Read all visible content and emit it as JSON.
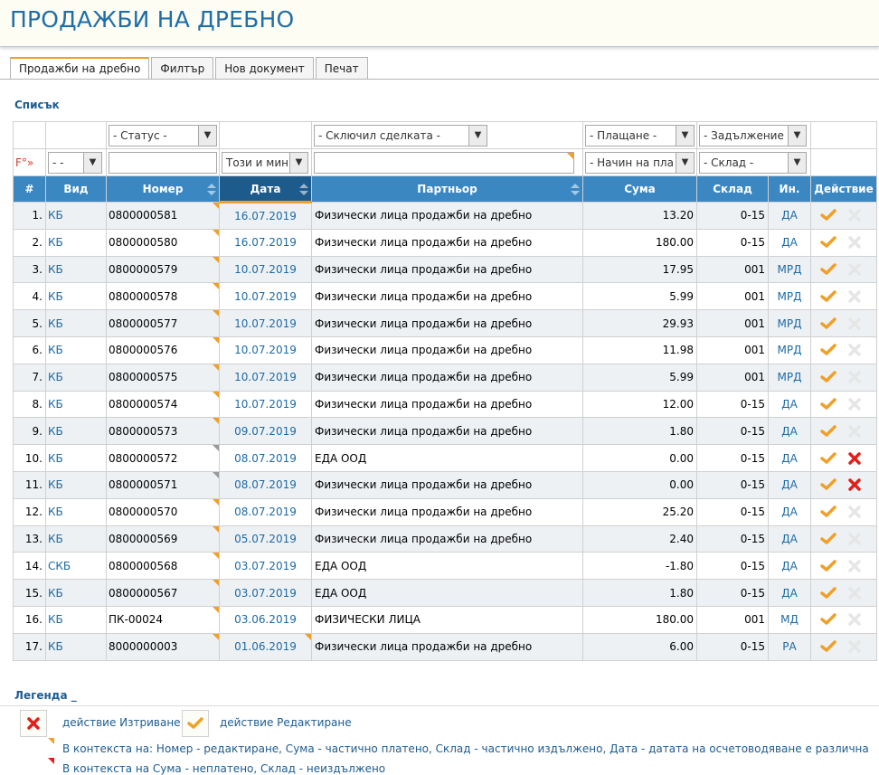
{
  "page": {
    "title": "ПРОДАЖБИ НА ДРЕБНО"
  },
  "tabs": [
    "Продажби на дребно",
    "Филтър",
    "Нов документ",
    "Печат"
  ],
  "section_title": "Списък",
  "filters": {
    "status": "- Статус -",
    "closed_by": "- Сключил сделката -",
    "payment": "- Плащане -",
    "debt": "- Задължение -",
    "fo_label": "F°»",
    "type": "- -",
    "period": "Този и мин",
    "payment_method": "- Начин на пла",
    "warehouse": "- Склад -"
  },
  "columns": [
    "#",
    "Вид",
    "Номер",
    "Дата",
    "Партньор",
    "Сума",
    "Склад",
    "Ин.",
    "Действие"
  ],
  "rows": [
    {
      "n": "1.",
      "vid": "КБ",
      "nomer": "0800000581",
      "date": "16.07.2019",
      "partner": "Физически лица продажби на дребно",
      "sum": "13.20",
      "sklad": "0-15",
      "in": "ДА",
      "del": false,
      "mark": "orange"
    },
    {
      "n": "2.",
      "vid": "КБ",
      "nomer": "0800000580",
      "date": "16.07.2019",
      "partner": "Физически лица продажби на дребно",
      "sum": "180.00",
      "sklad": "0-15",
      "in": "ДА",
      "del": false,
      "mark": "orange"
    },
    {
      "n": "3.",
      "vid": "КБ",
      "nomer": "0800000579",
      "date": "10.07.2019",
      "partner": "Физически лица продажби на дребно",
      "sum": "17.95",
      "sklad": "001",
      "in": "МРД",
      "del": false,
      "mark": "orange"
    },
    {
      "n": "4.",
      "vid": "КБ",
      "nomer": "0800000578",
      "date": "10.07.2019",
      "partner": "Физически лица продажби на дребно",
      "sum": "5.99",
      "sklad": "001",
      "in": "МРД",
      "del": false,
      "mark": "orange"
    },
    {
      "n": "5.",
      "vid": "КБ",
      "nomer": "0800000577",
      "date": "10.07.2019",
      "partner": "Физически лица продажби на дребно",
      "sum": "29.93",
      "sklad": "001",
      "in": "МРД",
      "del": false,
      "mark": "orange"
    },
    {
      "n": "6.",
      "vid": "КБ",
      "nomer": "0800000576",
      "date": "10.07.2019",
      "partner": "Физически лица продажби на дребно",
      "sum": "11.98",
      "sklad": "001",
      "in": "МРД",
      "del": false,
      "mark": "orange"
    },
    {
      "n": "7.",
      "vid": "КБ",
      "nomer": "0800000575",
      "date": "10.07.2019",
      "partner": "Физически лица продажби на дребно",
      "sum": "5.99",
      "sklad": "001",
      "in": "МРД",
      "del": false,
      "mark": "orange"
    },
    {
      "n": "8.",
      "vid": "КБ",
      "nomer": "0800000574",
      "date": "10.07.2019",
      "partner": "Физически лица продажби на дребно",
      "sum": "12.00",
      "sklad": "0-15",
      "in": "ДА",
      "del": false,
      "mark": "orange"
    },
    {
      "n": "9.",
      "vid": "КБ",
      "nomer": "0800000573",
      "date": "09.07.2019",
      "partner": "Физически лица продажби на дребно",
      "sum": "1.80",
      "sklad": "0-15",
      "in": "ДА",
      "del": false,
      "mark": "orange"
    },
    {
      "n": "10.",
      "vid": "КБ",
      "nomer": "0800000572",
      "date": "08.07.2019",
      "partner": "ЕДА ООД",
      "sum": "0.00",
      "sklad": "0-15",
      "in": "ДА",
      "del": true,
      "mark": "gray"
    },
    {
      "n": "11.",
      "vid": "КБ",
      "nomer": "0800000571",
      "date": "08.07.2019",
      "partner": "Физически лица продажби на дребно",
      "sum": "0.00",
      "sklad": "0-15",
      "in": "ДА",
      "del": true,
      "mark": "gray"
    },
    {
      "n": "12.",
      "vid": "КБ",
      "nomer": "0800000570",
      "date": "08.07.2019",
      "partner": "Физически лица продажби на дребно",
      "sum": "25.20",
      "sklad": "0-15",
      "in": "ДА",
      "del": false,
      "mark": "orange"
    },
    {
      "n": "13.",
      "vid": "КБ",
      "nomer": "0800000569",
      "date": "05.07.2019",
      "partner": "Физически лица продажби на дребно",
      "sum": "2.40",
      "sklad": "0-15",
      "in": "ДА",
      "del": false,
      "mark": "orange"
    },
    {
      "n": "14.",
      "vid": "СКБ",
      "nomer": "0800000568",
      "date": "03.07.2019",
      "partner": "ЕДА ООД",
      "sum": "-1.80",
      "sklad": "0-15",
      "in": "ДА",
      "del": false,
      "mark": "orange"
    },
    {
      "n": "15.",
      "vid": "КБ",
      "nomer": "0800000567",
      "date": "03.07.2019",
      "partner": "ЕДА ООД",
      "sum": "1.80",
      "sklad": "0-15",
      "in": "ДА",
      "del": false,
      "mark": "orange"
    },
    {
      "n": "16.",
      "vid": "КБ",
      "nomer": "ПК-00024",
      "date": "03.06.2019",
      "partner": "ФИЗИЧЕСКИ ЛИЦА",
      "sum": "180.00",
      "sklad": "001",
      "in": "МД",
      "del": false,
      "mark": "orange"
    },
    {
      "n": "17.",
      "vid": "КБ",
      "nomer": "8000000003",
      "date": "01.06.2019",
      "partner": "Физически лица продажби на дребно",
      "sum": "6.00",
      "sklad": "0-15",
      "in": "РА",
      "del": false,
      "mark": "orange",
      "date_mark": true
    }
  ],
  "legend": {
    "title": "Легенда _",
    "delete": "действие Изтриване",
    "edit": "действие Редактиране",
    "note1": "В контекста на: Номер - редактиране, Сума - частично платено, Склад - частично издължено, Дата - датата на осчетоводяване е различна",
    "note2": "В контекста на Сума - неплатено, Склад - неиздължено"
  },
  "colors": {
    "header_blue": "#3b87c2",
    "active_sort": "#1e5b8d",
    "accent_orange": "#f0a028",
    "delete_red": "#e0201a",
    "link_blue": "#1d6aa5"
  },
  "icons": {
    "edit": "check-icon",
    "delete": "close-icon",
    "dropdown": "chevron-down-icon",
    "sort": "sort-icon"
  }
}
